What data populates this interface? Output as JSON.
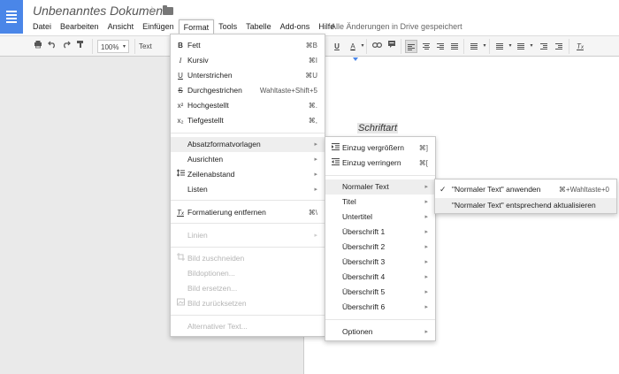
{
  "header": {
    "doc_title": "Unbenanntes Dokument",
    "save_status": "Alle Änderungen in Drive gespeichert"
  },
  "menubar": [
    "Datei",
    "Bearbeiten",
    "Ansicht",
    "Einfügen",
    "Format",
    "Tools",
    "Tabelle",
    "Add-ons",
    "Hilfe"
  ],
  "toolbar": {
    "zoom": "100%",
    "style": "Text"
  },
  "document": {
    "text": "Schriftart"
  },
  "format_menu": {
    "fett": "Fett",
    "fett_sc": "⌘B",
    "fett_icon": "B",
    "kursiv": "Kursiv",
    "kursiv_sc": "⌘I",
    "kursiv_icon": "I",
    "unterstrichen": "Unterstrichen",
    "unterstrichen_sc": "⌘U",
    "unterstrichen_icon": "U",
    "durchgestrichen": "Durchgestrichen",
    "durchgestrichen_sc": "Wahltaste+Shift+5",
    "durchgestrichen_icon": "S",
    "hochgestellt": "Hochgestellt",
    "hochgestellt_sc": "⌘.",
    "hochgestellt_icon": "x²",
    "tiefgestellt": "Tiefgestellt",
    "tiefgestellt_sc": "⌘,",
    "tiefgestellt_icon": "x₂",
    "absatz": "Absatzformatvorlagen",
    "ausrichten": "Ausrichten",
    "zeilenabstand": "Zeilenabstand",
    "listen": "Listen",
    "formatierung": "Formatierung entfernen",
    "formatierung_sc": "⌘\\",
    "linien": "Linien",
    "bild_zuschneiden": "Bild zuschneiden",
    "bildoptionen": "Bildoptionen...",
    "bild_ersetzen": "Bild ersetzen...",
    "bild_zuruecksetzen": "Bild zurücksetzen",
    "alternativer_text": "Alternativer Text...",
    "arrow": "▸"
  },
  "para_menu": {
    "einzug_vergroessern": "Einzug vergrößern",
    "einzug_vergroessern_sc": "⌘]",
    "einzug_verringern": "Einzug verringern",
    "einzug_verringern_sc": "⌘[",
    "normaler_text": "Normaler Text",
    "titel": "Titel",
    "untertitel": "Untertitel",
    "h1": "Überschrift 1",
    "h2": "Überschrift 2",
    "h3": "Überschrift 3",
    "h4": "Überschrift 4",
    "h5": "Überschrift 5",
    "h6": "Überschrift 6",
    "optionen": "Optionen"
  },
  "normal_menu": {
    "anwenden": "\"Normaler Text\" anwenden",
    "anwenden_sc": "⌘+Wahltaste+0",
    "aktualisieren": "\"Normaler Text\" entsprechend aktualisieren",
    "check": "✓"
  },
  "colors": {
    "brand_blue": "#4a86e8",
    "menu_highlight": "#eeeeee"
  }
}
